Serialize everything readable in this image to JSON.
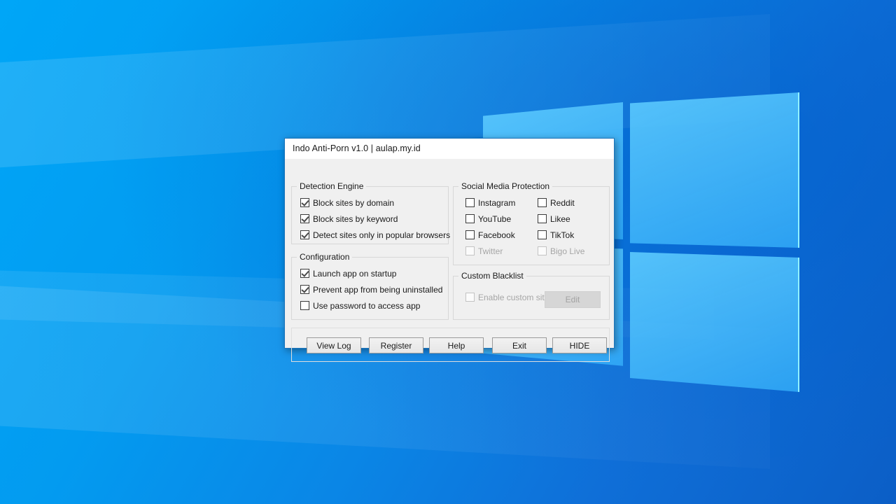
{
  "desktop": {
    "wallpaper_name": "windows-10-hero-wallpaper",
    "background_color": "#00a2f3",
    "accent_color": "#1c75bc"
  },
  "window": {
    "title": "Indo Anti-Porn v1.0 | aulap.my.id"
  },
  "groups": {
    "detection": {
      "title": "Detection Engine",
      "items": [
        {
          "label": "Block sites by domain",
          "checked": true,
          "enabled": true
        },
        {
          "label": "Block sites by keyword",
          "checked": true,
          "enabled": true
        },
        {
          "label": "Detect sites only in popular browsers",
          "checked": true,
          "enabled": true
        }
      ]
    },
    "configuration": {
      "title": "Configuration",
      "items": [
        {
          "label": "Launch app on startup",
          "checked": true,
          "enabled": true
        },
        {
          "label": "Prevent app from being uninstalled",
          "checked": true,
          "enabled": true
        },
        {
          "label": "Use password to access app",
          "checked": false,
          "enabled": true
        }
      ]
    },
    "social": {
      "title": "Social Media Protection",
      "column_left": [
        {
          "label": "Instagram",
          "checked": false,
          "enabled": true
        },
        {
          "label": "YouTube",
          "checked": false,
          "enabled": true
        },
        {
          "label": "Facebook",
          "checked": false,
          "enabled": true
        },
        {
          "label": "Twitter",
          "checked": false,
          "enabled": false
        }
      ],
      "column_right": [
        {
          "label": "Reddit",
          "checked": false,
          "enabled": true
        },
        {
          "label": "Likee",
          "checked": false,
          "enabled": true
        },
        {
          "label": "TikTok",
          "checked": false,
          "enabled": true
        },
        {
          "label": "Bigo Live",
          "checked": false,
          "enabled": false
        }
      ]
    },
    "blacklist": {
      "title": "Custom Blacklist",
      "enable_label": "Enable custom site",
      "enable_checked": false,
      "enable_enabled": false,
      "edit_label": "Edit",
      "edit_enabled": false
    }
  },
  "buttons": {
    "view_log": "View Log",
    "register": "Register",
    "help": "Help",
    "exit": "Exit",
    "hide": "HIDE"
  }
}
